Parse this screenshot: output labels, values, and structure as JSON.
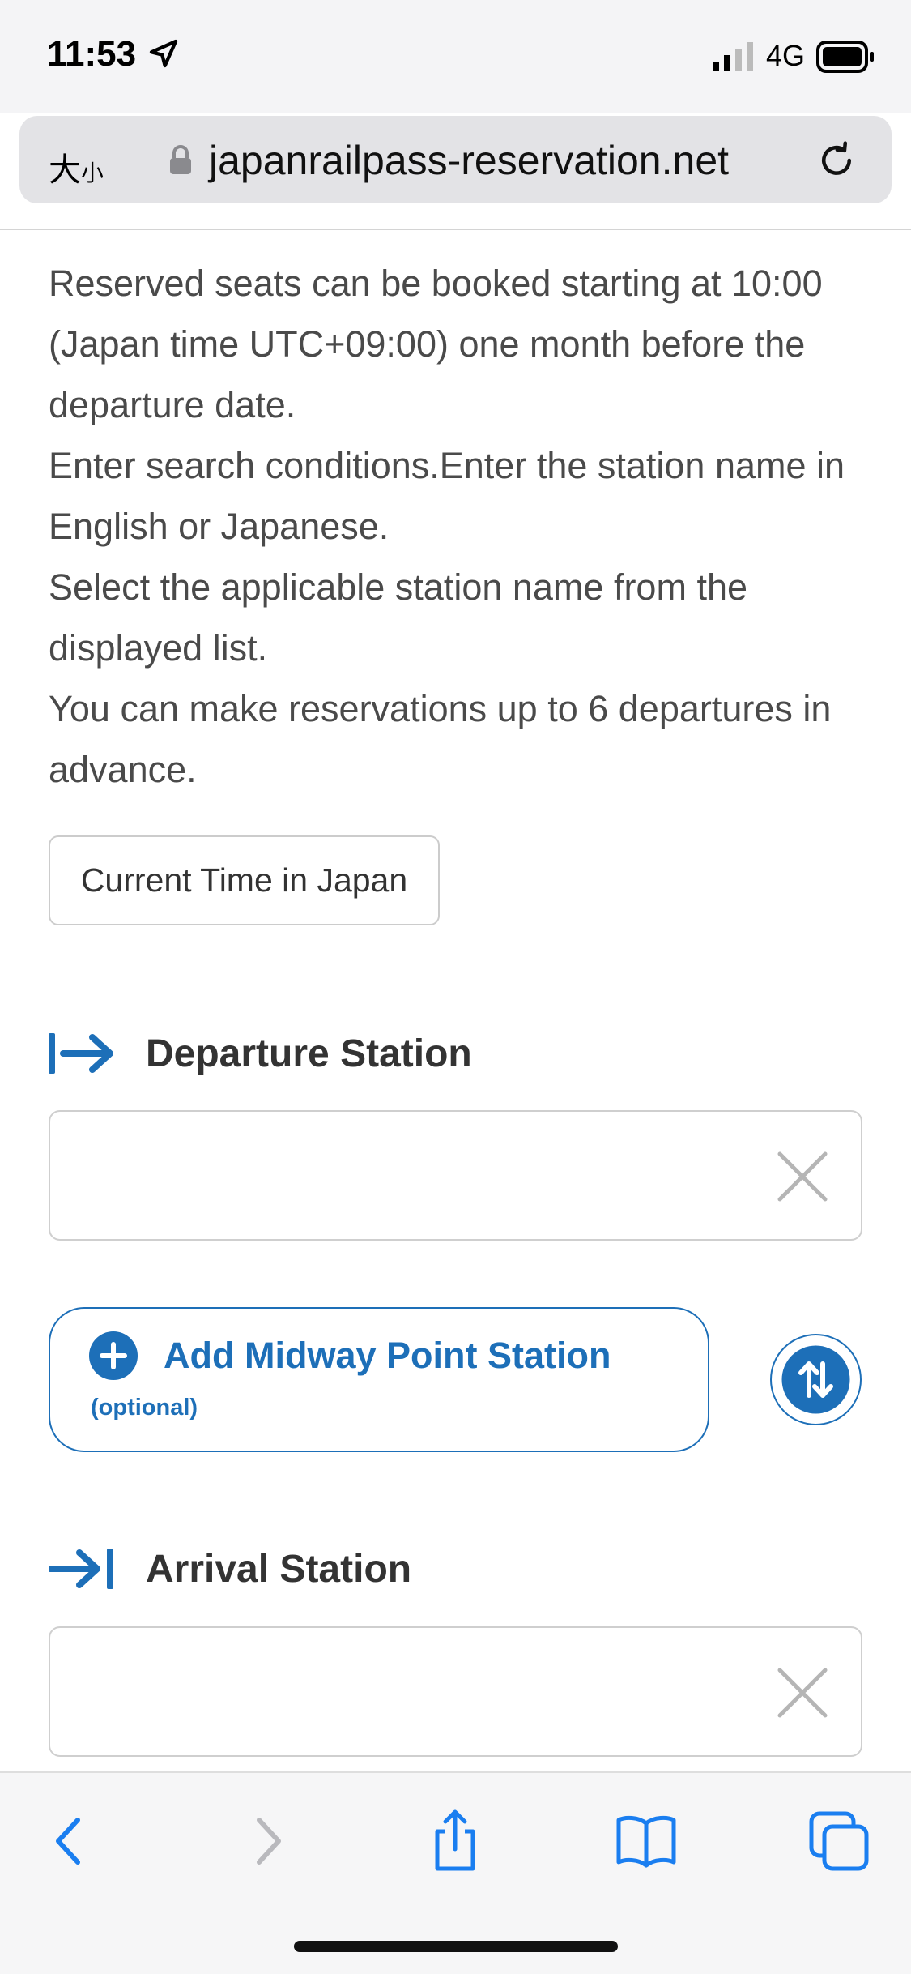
{
  "status_bar": {
    "time": "11:53",
    "network": "4G"
  },
  "browser": {
    "text_size_big": "大",
    "text_size_small": "小",
    "url": "japanrailpass-reservation.net"
  },
  "intro": {
    "paragraphs": [
      "Reserved seats can be booked starting at 10:00 (Japan time UTC+09:00) one month before the departure date.",
      "Enter search conditions.Enter the station name in English or Japanese.",
      "Select the applicable station name from the displayed list.",
      "You can make reservations up to 6 departures in advance."
    ]
  },
  "time_button_label": "Current Time in Japan",
  "departure": {
    "title": "Departure Station",
    "value": "",
    "placeholder": ""
  },
  "midway": {
    "label": "Add Midway Point Station",
    "sublabel": "(optional)"
  },
  "arrival": {
    "title": "Arrival Station",
    "value": "",
    "placeholder": ""
  },
  "icons": {
    "location": "location-arrow-icon",
    "signal": "cellular-signal-icon",
    "battery": "battery-icon",
    "lock": "lock-icon",
    "reload": "reload-icon",
    "departure": "departure-arrow-icon",
    "arrival": "arrival-arrow-icon",
    "clear": "clear-x-icon",
    "add": "plus-circle-icon",
    "swap": "swap-arrows-icon",
    "back": "back-chevron-icon",
    "forward": "forward-chevron-icon",
    "share": "share-icon",
    "bookmarks": "book-icon",
    "tabs": "tabs-icon"
  },
  "colors": {
    "accent": "#1d6fb8",
    "text": "#4a4a4a",
    "toolbar_icon": "#1a7ef0"
  }
}
